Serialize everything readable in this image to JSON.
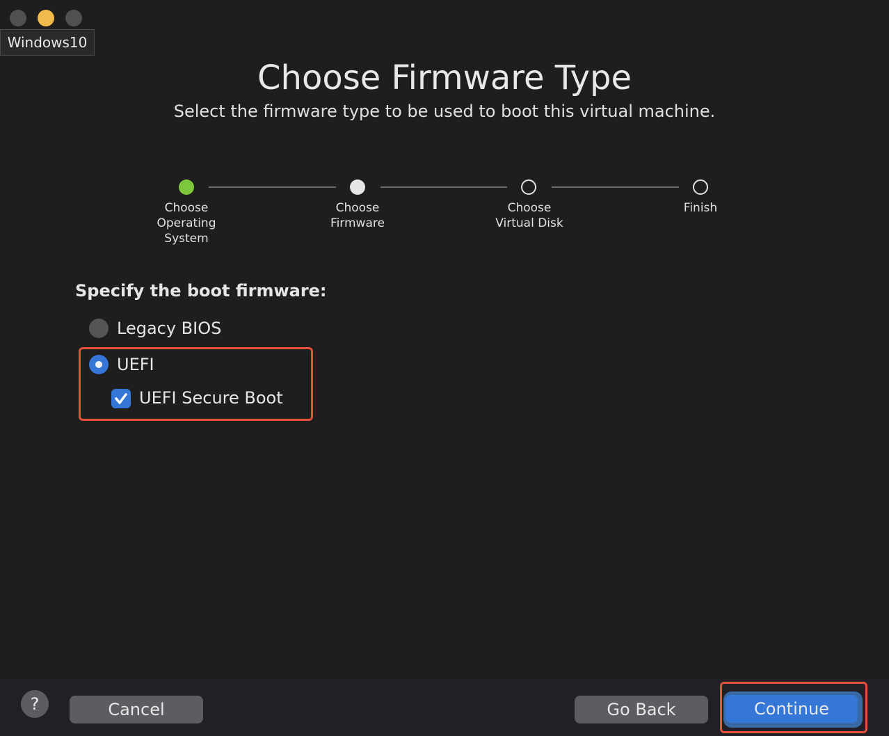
{
  "window": {
    "title": "Windows10",
    "traffic_lights": [
      "close",
      "minimize",
      "zoom"
    ]
  },
  "header": {
    "title": "Choose Firmware Type",
    "subtitle": "Select the firmware type to be used to boot this virtual machine."
  },
  "steps": [
    {
      "label1": "Choose",
      "label2": "Operating",
      "label3": "System",
      "state": "completed"
    },
    {
      "label1": "Choose",
      "label2": "Firmware",
      "state": "current"
    },
    {
      "label1": "Choose",
      "label2": "Virtual Disk",
      "state": "pending"
    },
    {
      "label1": "Finish",
      "state": "pending"
    }
  ],
  "firmware": {
    "heading": "Specify the boot firmware:",
    "options": [
      {
        "label": "Legacy BIOS",
        "selected": false
      },
      {
        "label": "UEFI",
        "selected": true
      }
    ],
    "secure_boot": {
      "label": "UEFI Secure Boot",
      "checked": true
    }
  },
  "footer": {
    "help": "?",
    "cancel": "Cancel",
    "go_back": "Go Back",
    "continue": "Continue"
  },
  "colors": {
    "accent": "#3477d6",
    "completed": "#7ec73c",
    "highlight": "#e2513a"
  }
}
